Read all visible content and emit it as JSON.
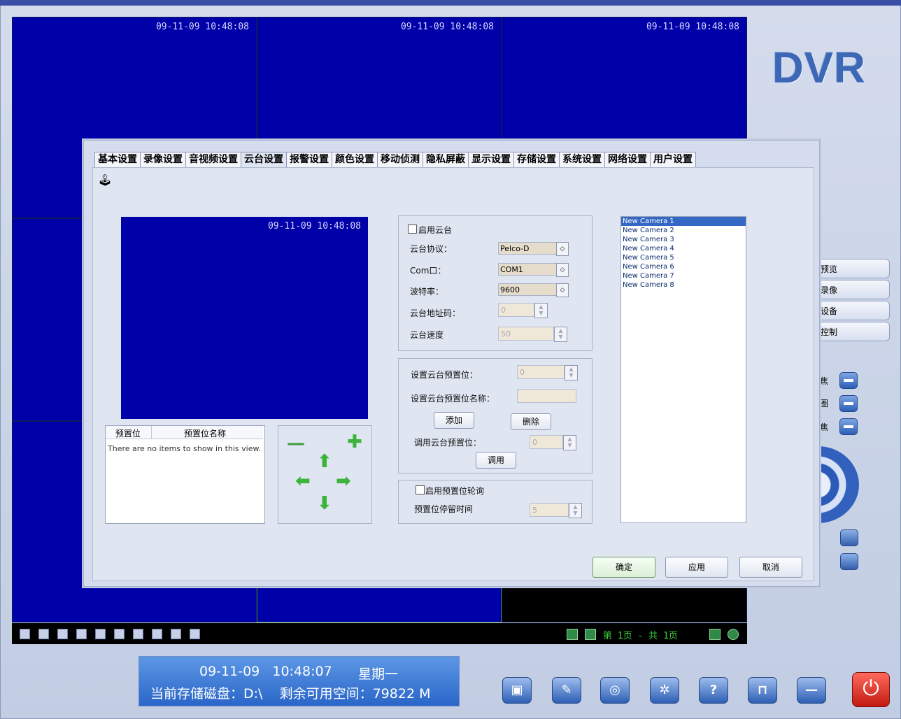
{
  "brand": "DVR",
  "timestamps": [
    "09-11-09 10:48:08",
    "09-11-09 10:48:08",
    "09-11-09 10:48:08"
  ],
  "side_buttons": [
    "预览",
    "录像",
    "设备",
    "控制"
  ],
  "side_labels": [
    "焦",
    "圈",
    "焦"
  ],
  "pageinfo": "第 1页 - 共 1页",
  "status": {
    "date": "09-11-09",
    "time": "10:48:07",
    "weekday": "星期一",
    "disk_line": "当前存储磁盘：D:\\    剩余可用空间：79822 M"
  },
  "dialog": {
    "tabs": [
      "基本设置",
      "录像设置",
      "音视频设置",
      "云台设置",
      "报警设置",
      "颜色设置",
      "移动侦测",
      "隐私屏蔽",
      "显示设置",
      "存储设置",
      "系统设置",
      "网络设置",
      "用户设置"
    ],
    "active_tab": 3,
    "preview_ts": "09-11-09 10:48:08",
    "preset_list": {
      "col1": "预置位",
      "col2": "预置位名称",
      "empty": "There are no items to show in this view."
    },
    "ptz": {
      "enable": "启用云台",
      "protocol_label": "云台协议：",
      "protocol": "Pelco-D",
      "com_label": "Com口：",
      "com": "COM1",
      "baud_label": "波特率：",
      "baud": "9600",
      "addr_label": "云台地址码：",
      "addr": "0",
      "speed_label": "云台速度",
      "speed": "50"
    },
    "preset": {
      "set_label": "设置云台预置位：",
      "set_value": "0",
      "name_label": "设置云台预置位名称：",
      "add": "添加",
      "delete": "删除",
      "call_label": "调用云台预置位：",
      "call_value": "0",
      "call": "调用"
    },
    "cruise": {
      "enable": "启用预置位轮询",
      "dwell_label": "预置位停留时间",
      "dwell": "5"
    },
    "cameras": [
      "New Camera 1",
      "New Camera 2",
      "New Camera 3",
      "New Camera 4",
      "New Camera 5",
      "New Camera 6",
      "New Camera 7",
      "New Camera 8"
    ],
    "ok": "确定",
    "apply": "应用",
    "cancel": "取消"
  }
}
